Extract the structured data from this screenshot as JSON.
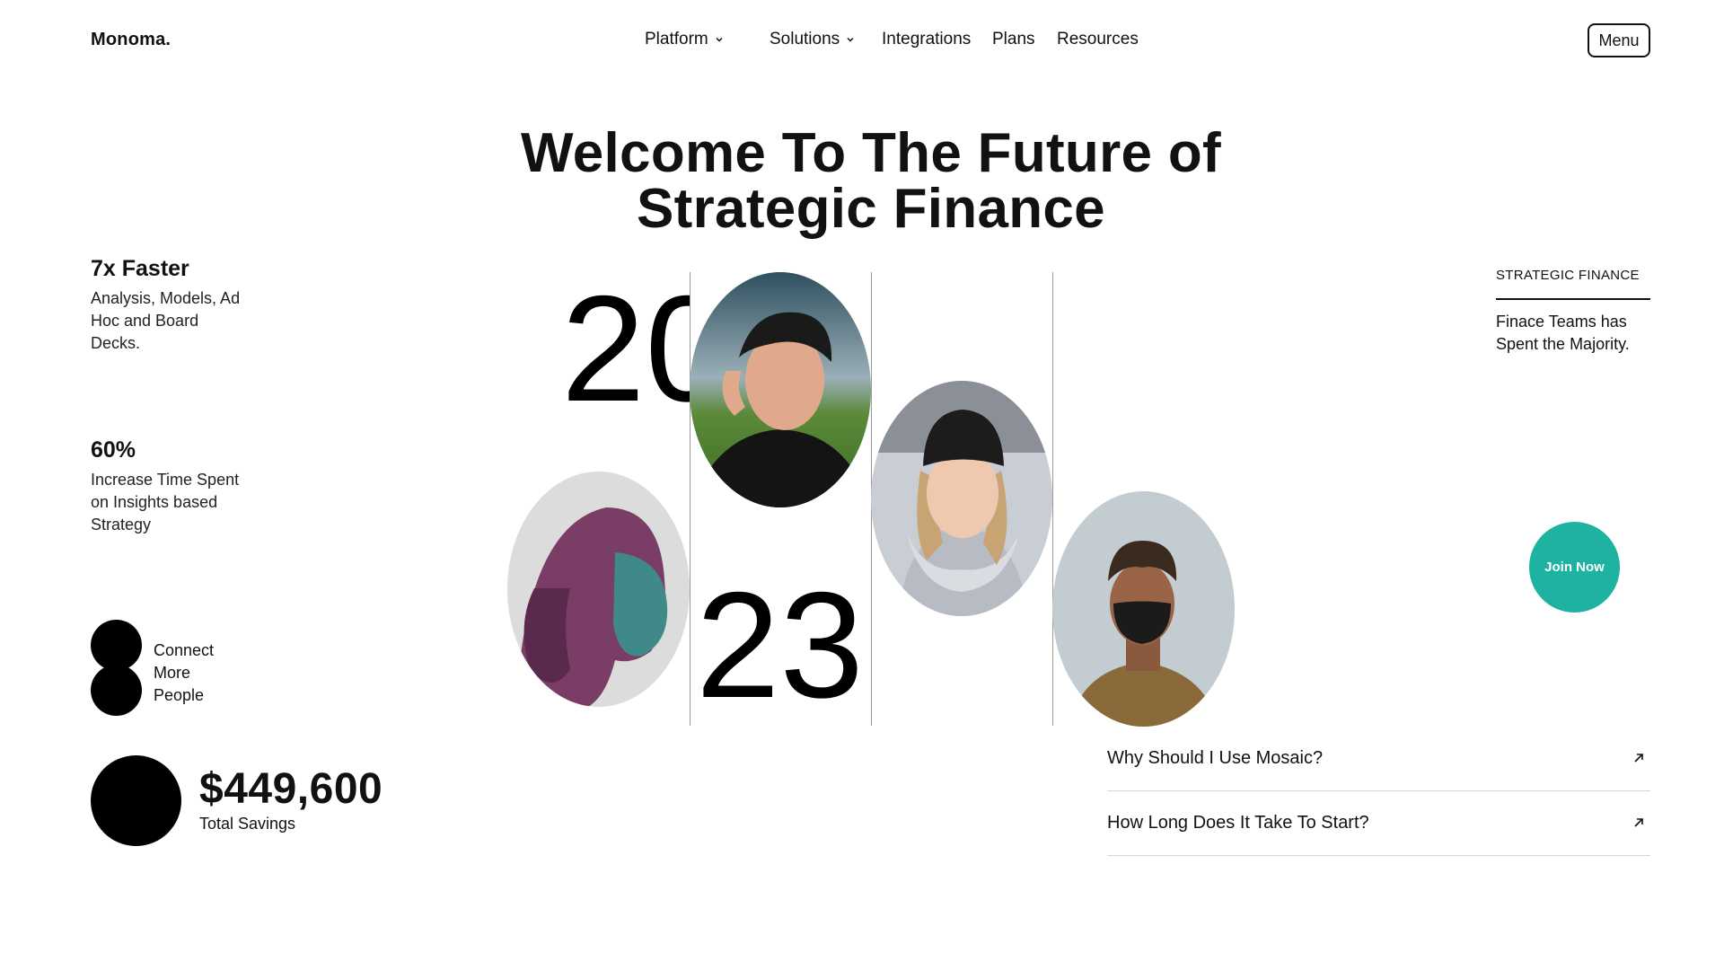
{
  "header": {
    "logo": "Monoma.",
    "nav": [
      {
        "label": "Platform",
        "has_dropdown": true
      },
      {
        "label": "Solutions",
        "has_dropdown": true
      },
      {
        "label": "Integrations",
        "has_dropdown": false
      },
      {
        "label": "Plans",
        "has_dropdown": false
      },
      {
        "label": "Resources",
        "has_dropdown": false
      }
    ],
    "menu_label": "Menu"
  },
  "hero": {
    "title_line1": "Welcome To The Future of",
    "title_line2": "Strategic Finance",
    "year_top": "20",
    "year_bottom": "23"
  },
  "stats": [
    {
      "title": "7x Faster",
      "description": "Analysis, Models, Ad Hoc and Board Decks."
    },
    {
      "title": "60%",
      "description": "Increase Time Spent on Insights based Strategy"
    }
  ],
  "connect": {
    "label": "Connect More People"
  },
  "savings": {
    "amount": "$449,600",
    "label": "Total Savings"
  },
  "sidebar": {
    "kicker": "STRATEGIC FINANCE",
    "description": "Finace Teams has Spent the Majority."
  },
  "join_label": "Join Now",
  "faq": [
    {
      "question": "Why Should I Use Mosaic?",
      "icon": "arrow-up-right-icon"
    },
    {
      "question": "How Long Does It Take To Start?",
      "icon": "arrow-up-right-icon"
    }
  ],
  "colors": {
    "accent": "#1db3a0",
    "text": "#111111",
    "background": "#ffffff"
  }
}
